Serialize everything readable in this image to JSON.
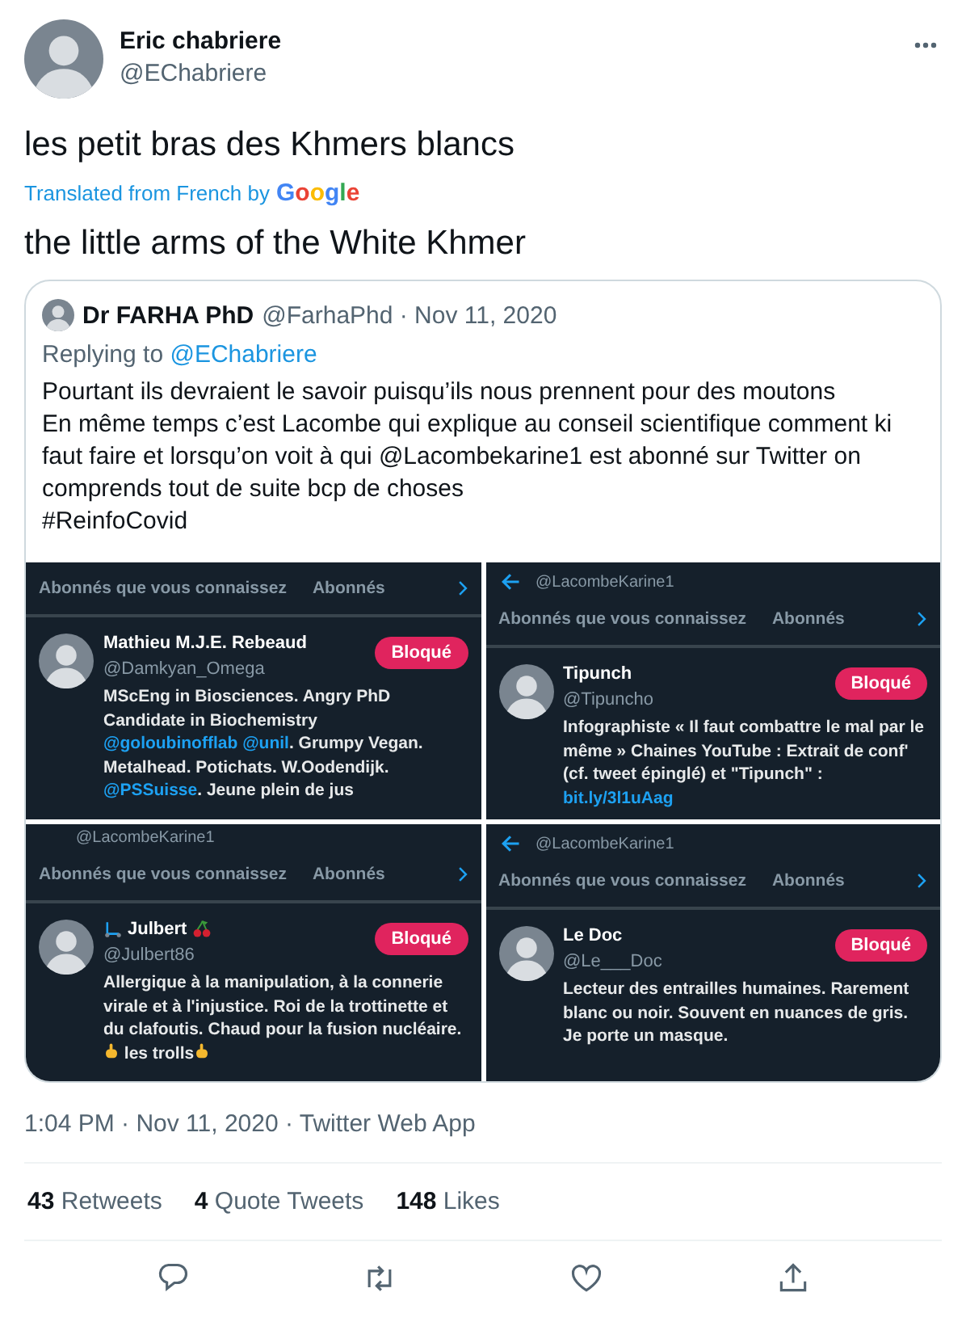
{
  "author": {
    "name": "Eric chabriere",
    "handle": "@EChabriere"
  },
  "text": "les petit bras des Khmers blancs",
  "translation_note": {
    "label": "Translated from French by",
    "provider": "Google"
  },
  "translation": "the little arms of the White Khmer",
  "quote": {
    "name": "Dr FARHA PhD",
    "meta": "@FarhaPhd · Nov 11, 2020",
    "replying_label": "Replying to",
    "replying_to": "@EChabriere",
    "lines": [
      "Pourtant ils devraient le savoir puisqu’ils nous prennent pour des moutons",
      "En même temps c’est Lacombe qui explique au conseil scientifique comment ki faut faire et lorsqu’on voit à qui @Lacombekarine1 est abonné sur Twitter on comprends tout de suite bcp de choses",
      "#ReinfoCovid"
    ],
    "panels": [
      {
        "back_arrow": false,
        "tabs": [
          "Abonnés que vous connaissez",
          "Abonnés"
        ],
        "user": {
          "name": "Mathieu M.J.E. Rebeaud",
          "handle": "@Damkyan_Omega",
          "button": "Bloqué",
          "bio": [
            {
              "kind": "text",
              "text": "MScEng in Biosciences. Angry PhD Candidate in Biochemistry "
            },
            {
              "kind": "link",
              "text": "@goloubinofflab "
            },
            {
              "kind": "link",
              "text": "@unil"
            },
            {
              "kind": "text",
              "text": ". Grumpy Vegan. Metalhead. Potichats. W.Oodendijk. "
            },
            {
              "kind": "link",
              "text": "@PSSuisse"
            },
            {
              "kind": "text",
              "text": ". Jeune plein de jus"
            }
          ]
        }
      },
      {
        "back_arrow": true,
        "top_handle": "@LacombeKarine1",
        "tabs": [
          "Abonnés que vous connaissez",
          "Abonnés"
        ],
        "user": {
          "name": "Tipunch",
          "handle": "@Tipuncho",
          "button": "Bloqué",
          "bio": [
            {
              "kind": "text",
              "text": "Infographiste « Il faut combattre le mal par le même » Chaines YouTube : Extrait de conf' (cf. tweet épinglé) et \"Tipunch\" : "
            },
            {
              "kind": "link",
              "text": "bit.ly/3l1uAag"
            }
          ]
        }
      },
      {
        "back_arrow": false,
        "top_handle": "@LacombeKarine1",
        "tabs": [
          "Abonnés que vous connaissez",
          "Abonnés"
        ],
        "user": {
          "name": "Julbert",
          "name_decor": {
            "before": {
              "kind": "scooter"
            },
            "after": {
              "kind": "cherry"
            }
          },
          "handle": "@Julbert86",
          "button": "Bloqué",
          "bio": [
            {
              "kind": "text",
              "text": "Allergique à la manipulation, à la connerie virale et à l'injustice. Roi de la trottinette et du clafoutis. Chaud pour la fusion nucléaire. "
            },
            {
              "kind": "icon"
            },
            {
              "kind": "text",
              "text": " les trolls"
            },
            {
              "kind": "icon"
            }
          ]
        }
      },
      {
        "back_arrow": true,
        "top_handle": "@LacombeKarine1",
        "tabs": [
          "Abonnés que vous connaissez",
          "Abonnés"
        ],
        "user": {
          "name": "Le Doc",
          "handle": "@Le___Doc",
          "button": "Bloqué",
          "bio": [
            {
              "kind": "text",
              "text": "Lecteur des entrailles humaines. Rarement blanc ou noir. Souvent en nuances de gris. Je porte un masque."
            }
          ]
        }
      }
    ]
  },
  "timestamp": "1:04 PM · Nov 11, 2020 · Twitter Web App",
  "stats": [
    {
      "count": "43",
      "label": "Retweets"
    },
    {
      "count": "4",
      "label": "Quote Tweets"
    },
    {
      "count": "148",
      "label": "Likes"
    }
  ],
  "actions": [
    {
      "kind": "reply"
    },
    {
      "kind": "retweet"
    },
    {
      "kind": "like"
    },
    {
      "kind": "share"
    }
  ]
}
